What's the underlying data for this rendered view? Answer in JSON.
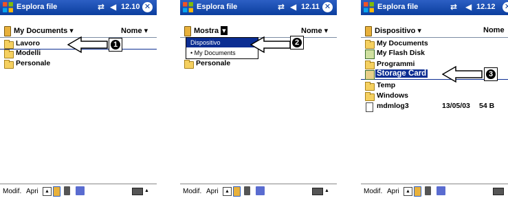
{
  "colors": {
    "title_bar": "#0b3e9e",
    "selection": "#0b2d92",
    "folder": "#f5d060"
  },
  "screens": [
    {
      "app_title": "Esplora file",
      "time": "12.10",
      "header": {
        "label": "My Documents",
        "sort": "Nome"
      },
      "items": [
        {
          "label": "Lavoro",
          "icon": "folder-icon",
          "selected": true
        },
        {
          "label": "Modelli",
          "icon": "folder-icon"
        },
        {
          "label": "Personale",
          "icon": "folder-icon"
        }
      ],
      "callout": "1",
      "taskbar": {
        "edit": "Modif.",
        "open": "Apri"
      }
    },
    {
      "app_title": "Esplora file",
      "time": "12.11",
      "header": {
        "label": "Mostra",
        "sort": "Nome"
      },
      "menu": [
        {
          "label": "Dispositivo",
          "highlighted": true
        },
        {
          "label": "• My Documents"
        }
      ],
      "items": [
        {
          "label": "Personale",
          "icon": "folder-icon"
        }
      ],
      "callout": "2",
      "taskbar": {
        "edit": "Modif.",
        "open": "Apri"
      }
    },
    {
      "app_title": "Esplora file",
      "time": "12.12",
      "header": {
        "label": "Dispositivo",
        "sort": "Nome"
      },
      "items": [
        {
          "label": "My Documents",
          "icon": "folder-icon"
        },
        {
          "label": "My Flash Disk",
          "icon": "flash-disk-icon"
        },
        {
          "label": "Programmi",
          "icon": "folder-icon"
        },
        {
          "label": "Storage Card",
          "icon": "storage-card-icon",
          "selected": true
        },
        {
          "label": "Temp",
          "icon": "folder-icon"
        },
        {
          "label": "Windows",
          "icon": "folder-icon"
        },
        {
          "label": "mdmlog3",
          "icon": "file-icon",
          "date": "13/05/03",
          "size": "54 B"
        }
      ],
      "callout": "3",
      "taskbar": {
        "edit": "Modif.",
        "open": "Apri"
      }
    }
  ]
}
